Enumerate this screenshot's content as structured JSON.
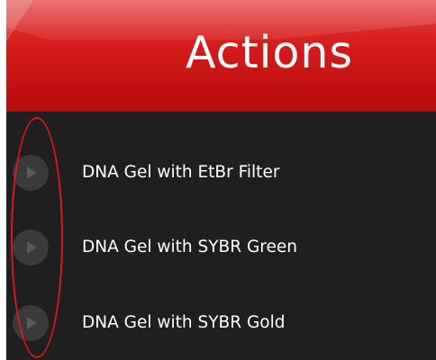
{
  "header": {
    "title": "Actions"
  },
  "actions": {
    "items": [
      {
        "label": "DNA Gel with EtBr Filter",
        "icon": "play-icon"
      },
      {
        "label": "DNA Gel with SYBR Green",
        "icon": "play-icon"
      },
      {
        "label": "DNA Gel with SYBR Gold",
        "icon": "play-icon"
      }
    ]
  },
  "colors": {
    "header_red": "#d41a1a",
    "panel_bg": "#1f1f1f",
    "icon_circle": "#3a3a3a",
    "annotation_red": "#e0161c"
  }
}
